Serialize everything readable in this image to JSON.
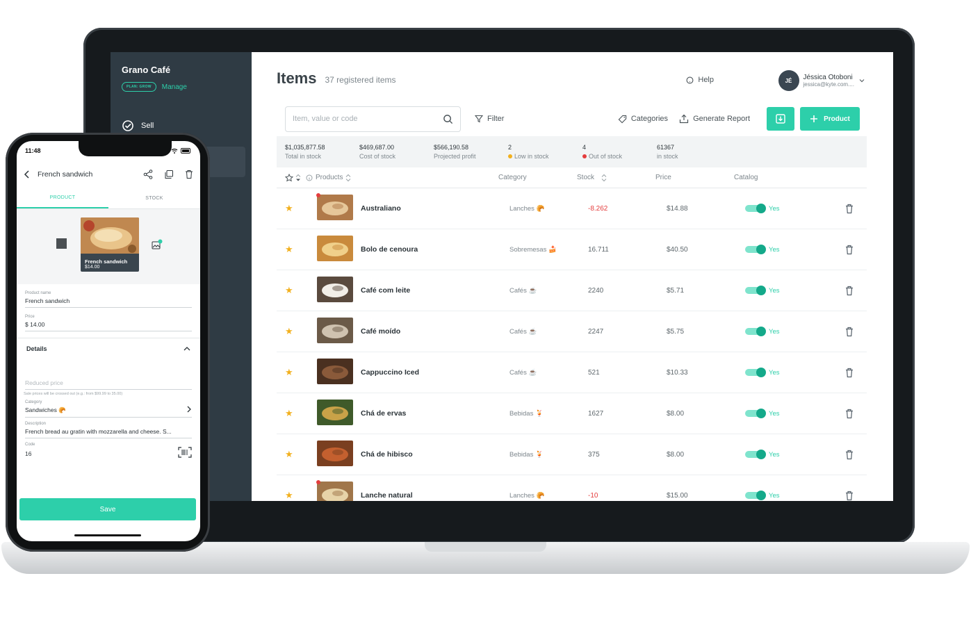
{
  "desktop": {
    "sidebar": {
      "brand": "Grano Café",
      "plan_badge": "PLAN: GROW",
      "manage_label": "Manage",
      "items": [
        {
          "label": "Sell",
          "icon": "check-circle-icon"
        }
      ]
    },
    "header": {
      "title": "Items",
      "subtitle": "37 registered items",
      "help_label": "Help",
      "user": {
        "initials": "JÉ",
        "name": "Jéssica Otoboni",
        "email": "jessica@kyte.com...."
      }
    },
    "toolbar": {
      "search_placeholder": "Item, value or code",
      "filter_label": "Filter",
      "categories_label": "Categories",
      "report_label": "Generate Report",
      "product_button": "Product"
    },
    "summary": [
      {
        "value": "$1,035,877.58",
        "label": "Total in stock"
      },
      {
        "value": "$469,687.00",
        "label": "Cost of stock"
      },
      {
        "value": "$566,190.58",
        "label": "Projected profit"
      },
      {
        "value": "2",
        "label": "Low in stock",
        "dot": "#f2b01e"
      },
      {
        "value": "4",
        "label": "Out of stock",
        "dot": "#e43d3d"
      },
      {
        "value": "61367",
        "label": "in stock"
      }
    ],
    "table": {
      "headers": {
        "products": "Products",
        "category": "Category",
        "stock": "Stock",
        "price": "Price",
        "catalog": "Catalog"
      },
      "rows": [
        {
          "name": "Australiano",
          "category": "Lanches 🥐",
          "stock": "-8.262",
          "price": "$14.88",
          "catalog": "Yes",
          "alert": true
        },
        {
          "name": "Bolo de cenoura",
          "category": "Sobremesas 🍰",
          "stock": "16.711",
          "price": "$40.50",
          "catalog": "Yes",
          "alert": false
        },
        {
          "name": "Café com leite",
          "category": "Cafés ☕",
          "stock": "2240",
          "price": "$5.71",
          "catalog": "Yes",
          "alert": false
        },
        {
          "name": "Café moído",
          "category": "Cafés ☕",
          "stock": "2247",
          "price": "$5.75",
          "catalog": "Yes",
          "alert": false
        },
        {
          "name": "Cappuccino Iced",
          "category": "Cafés ☕",
          "stock": "521",
          "price": "$10.33",
          "catalog": "Yes",
          "alert": false
        },
        {
          "name": "Chá de ervas",
          "category": "Bebidas 🍹",
          "stock": "1627",
          "price": "$8.00",
          "catalog": "Yes",
          "alert": false
        },
        {
          "name": "Chá de hibisco",
          "category": "Bebidas 🍹",
          "stock": "375",
          "price": "$8.00",
          "catalog": "Yes",
          "alert": false
        },
        {
          "name": "Lanche natural",
          "category": "Lanches 🥐",
          "stock": "-10",
          "price": "$15.00",
          "catalog": "Yes",
          "alert": true
        }
      ]
    }
  },
  "mobile": {
    "time": "11:48",
    "title": "French sandwich",
    "tabs": [
      "PRODUCT",
      "STOCK"
    ],
    "card": {
      "name": "French sandwich",
      "price": "$14.00"
    },
    "fields": {
      "product_name": {
        "label": "Product name",
        "value": "French sandwich"
      },
      "price": {
        "label": "Price",
        "value": "$ 14.00"
      },
      "details_label": "Details",
      "reduced_price": {
        "placeholder": "Reduced price",
        "hint": "Sale prices will be crossed out (e.g.: from $99.99 to 35.00)"
      },
      "category": {
        "label": "Category",
        "value": "Sandwiches 🥐"
      },
      "description": {
        "label": "Description",
        "value": "French bread au gratin with mozzarella and cheese. S..."
      },
      "code": {
        "label": "Code",
        "value": "16"
      }
    },
    "save_label": "Save"
  },
  "colors": {
    "accent": "#2dcfaa",
    "sidebar": "#2f3b44",
    "danger": "#e43d3d",
    "star": "#f2b01e"
  }
}
